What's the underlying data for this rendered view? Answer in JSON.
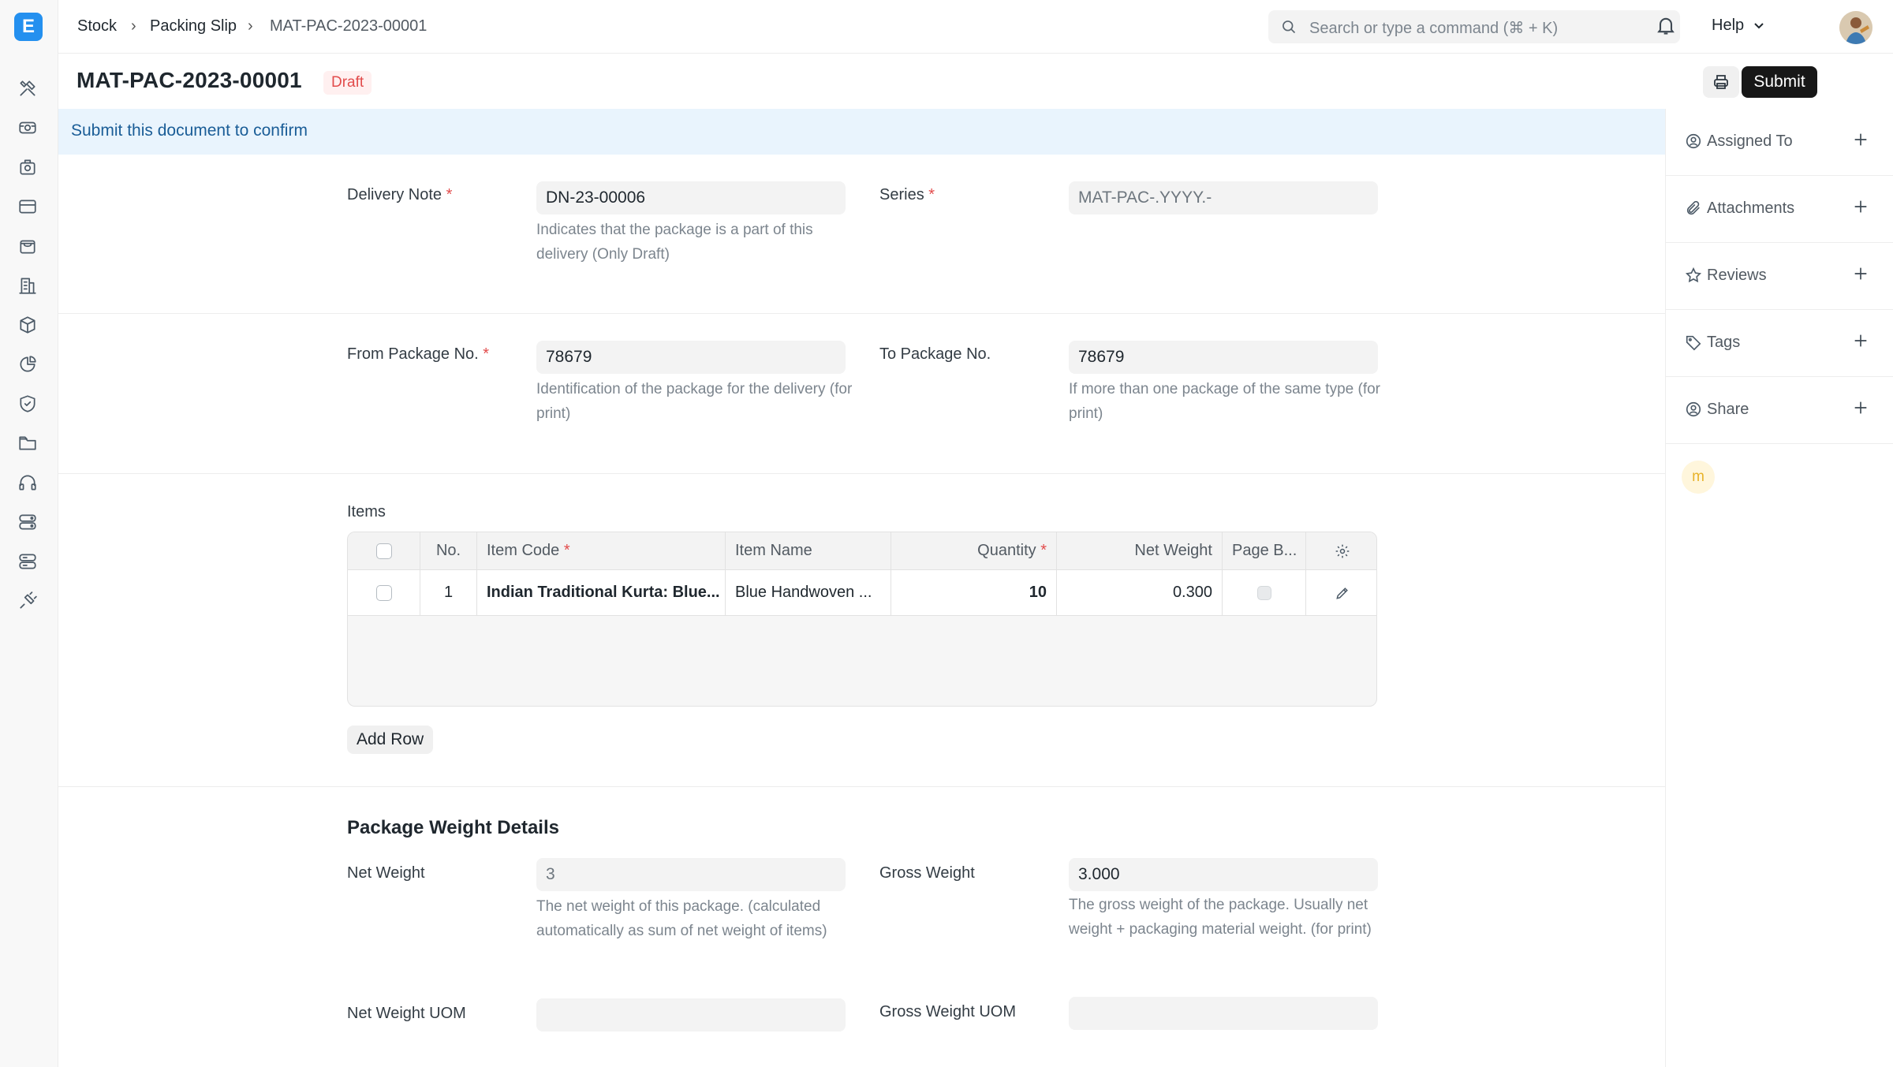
{
  "app": {
    "logo_letter": "E"
  },
  "breadcrumb": {
    "items": [
      "Stock",
      "Packing Slip",
      "MAT-PAC-2023-00001"
    ]
  },
  "search": {
    "placeholder": "Search or type a command (⌘ + K)"
  },
  "navbar": {
    "help_label": "Help"
  },
  "rail_icons": [
    "tools-icon",
    "projector-icon",
    "camera-icon",
    "card-icon",
    "bag-icon",
    "building-icon",
    "box-icon",
    "pie-chart-icon",
    "shield-icon",
    "folder-icon",
    "headset-icon",
    "server-icon",
    "database-icon",
    "plug-icon"
  ],
  "page": {
    "title": "MAT-PAC-2023-00001",
    "status": "Draft",
    "submit_label": "Submit"
  },
  "banner": {
    "text": "Submit this document to confirm"
  },
  "form": {
    "delivery_note": {
      "label": "Delivery Note",
      "required": "*",
      "value": "DN-23-00006",
      "help": "Indicates that the package is a part of this delivery (Only Draft)"
    },
    "series": {
      "label": "Series",
      "required": "*",
      "value": "MAT-PAC-.YYYY.-"
    },
    "from_package": {
      "label": "From Package No.",
      "required": "*",
      "value": "78679",
      "help": "Identification of the package for the delivery (for print)"
    },
    "to_package": {
      "label": "To Package No.",
      "value": "78679",
      "help": "If more than one package of the same type (for print)"
    },
    "items": {
      "label": "Items",
      "columns": {
        "no": "No.",
        "item_code": "Item Code",
        "item_name": "Item Name",
        "quantity": "Quantity",
        "net_weight": "Net Weight",
        "page_break": "Page B...",
        "required": "*"
      },
      "rows": [
        {
          "no": "1",
          "item_code": "Indian Traditional Kurta: Blue...",
          "item_name": "Blue Handwoven ...",
          "quantity": "10",
          "net_weight": "0.300"
        }
      ],
      "add_row_label": "Add Row"
    },
    "weight_section": {
      "title": "Package Weight Details",
      "net_weight": {
        "label": "Net Weight",
        "value": "3",
        "help": "The net weight of this package. (calculated automatically as sum of net weight of items)"
      },
      "gross_weight": {
        "label": "Gross Weight",
        "value": "3.000",
        "help": "The gross weight of the package. Usually net weight + packaging material weight. (for print)"
      },
      "net_weight_uom": {
        "label": "Net Weight UOM",
        "value": ""
      },
      "gross_weight_uom": {
        "label": "Gross Weight UOM",
        "value": ""
      }
    }
  },
  "sidebar": {
    "items": [
      {
        "label": "Assigned To",
        "icon": "assign-icon"
      },
      {
        "label": "Attachments",
        "icon": "paperclip-icon"
      },
      {
        "label": "Reviews",
        "icon": "star-icon"
      },
      {
        "label": "Tags",
        "icon": "tag-icon"
      },
      {
        "label": "Share",
        "icon": "share-icon"
      }
    ],
    "viewer_initial": "m"
  },
  "colors": {
    "primary": "#2490ef",
    "draft_text": "#e24c4c",
    "draft_bg": "#fff0f0",
    "banner_bg": "#e9f4fd",
    "banner_text": "#1a5d97",
    "submit_bg": "#171717"
  }
}
